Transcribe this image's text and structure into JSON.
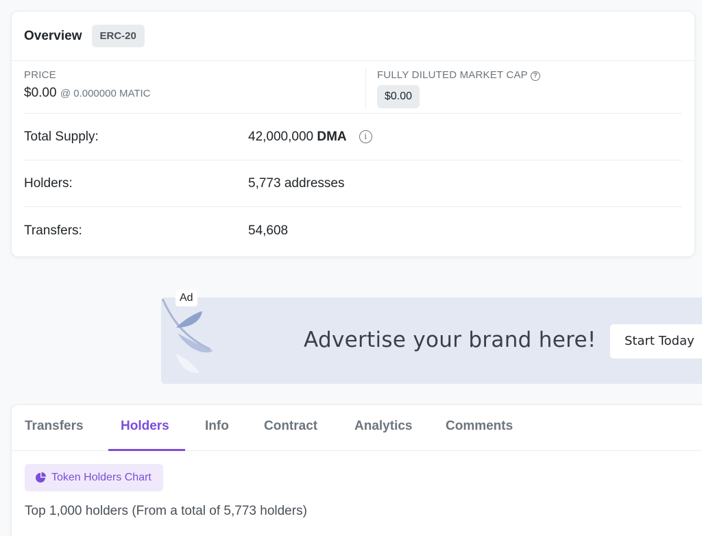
{
  "overview": {
    "title": "Overview",
    "badge": "ERC-20",
    "price_label": "PRICE",
    "price_value": "$0.00",
    "price_matic": "@ 0.000000 MATIC",
    "mcap_label": "FULLY DILUTED MARKET CAP",
    "mcap_value": "$0.00",
    "rows": [
      {
        "label": "Total Supply:",
        "value": "42,000,000",
        "unit": "DMA"
      },
      {
        "label": "Holders:",
        "value": "5,773 addresses"
      },
      {
        "label": "Transfers:",
        "value": "54,608"
      }
    ]
  },
  "ad": {
    "tag": "Ad",
    "text": "Advertise your brand here!",
    "button": "Start Today"
  },
  "tabs": [
    {
      "label": "Transfers"
    },
    {
      "label": "Holders",
      "active": true
    },
    {
      "label": "Info"
    },
    {
      "label": "Contract"
    },
    {
      "label": "Analytics"
    },
    {
      "label": "Comments"
    }
  ],
  "holders": {
    "chart_button": "Token Holders Chart",
    "note": "Top 1,000 holders (From a total of 5,773 holders)"
  },
  "colors": {
    "accent": "#7c4ddb",
    "ad_bg": "#e4e8f2",
    "badge_bg": "#e9ecef"
  }
}
